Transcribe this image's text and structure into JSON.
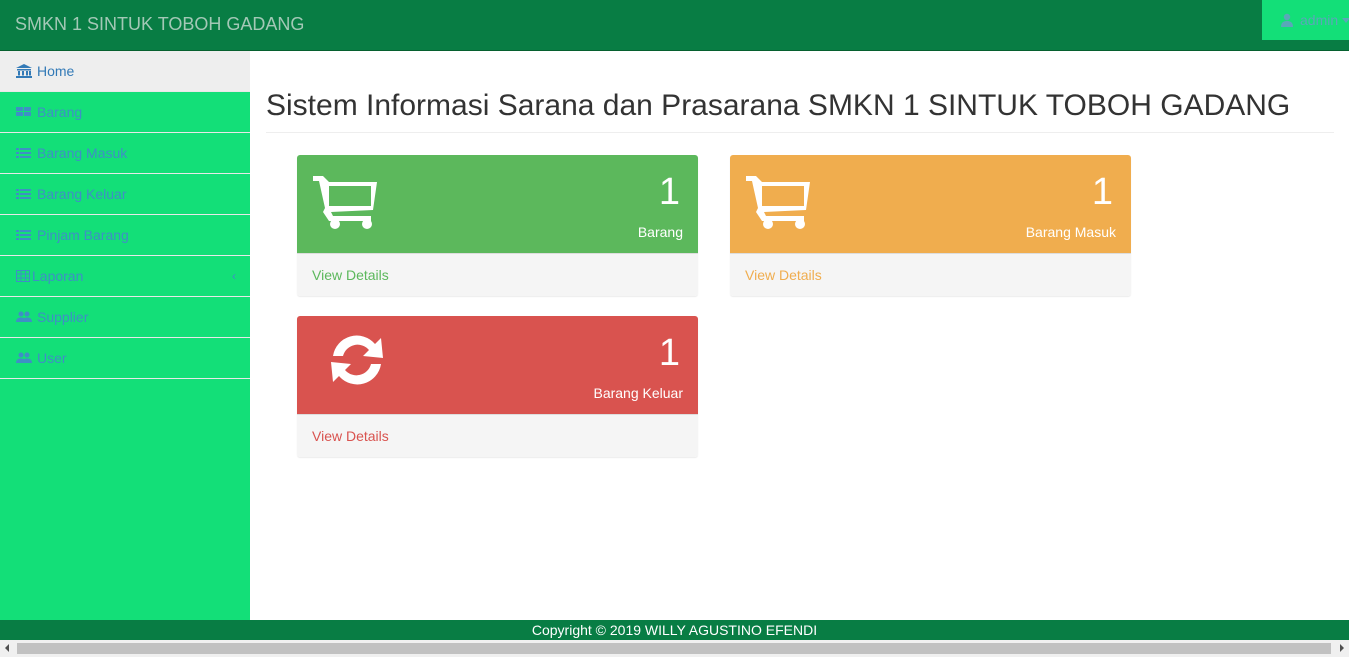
{
  "navbar": {
    "brand": "SMKN 1 SINTUK TOBOH GADANG",
    "user": "admin",
    "user_icon": "user-icon"
  },
  "sidebar": {
    "items": [
      {
        "label": "Home",
        "icon": "bank-icon"
      },
      {
        "label": "Barang",
        "icon": "grid-icon"
      },
      {
        "label": "Barang Masuk",
        "icon": "list-icon"
      },
      {
        "label": "Barang Keluar",
        "icon": "list-icon"
      },
      {
        "label": "Pinjam Barang",
        "icon": "list-icon"
      },
      {
        "label": "Laporan",
        "icon": "table-icon"
      },
      {
        "label": "Supplier",
        "icon": "users-icon"
      },
      {
        "label": "User",
        "icon": "users-icon"
      }
    ]
  },
  "main": {
    "title": "Sistem Informasi Sarana dan Prasarana SMKN 1 SINTUK TOBOH GADANG",
    "cards": [
      {
        "count": "1",
        "label": "Barang",
        "link": "View Details",
        "color": "#5cb85c",
        "icon": "cart-icon"
      },
      {
        "count": "1",
        "label": "Barang Masuk",
        "link": "View Details",
        "color": "#f0ad4e",
        "icon": "cart-icon"
      },
      {
        "count": "1",
        "label": "Barang Keluar",
        "link": "View Details",
        "color": "#d9534f",
        "icon": "refresh-icon"
      }
    ]
  },
  "footer": {
    "text": "Copyright © 2019 WILLY AGUSTINO EFENDI"
  }
}
